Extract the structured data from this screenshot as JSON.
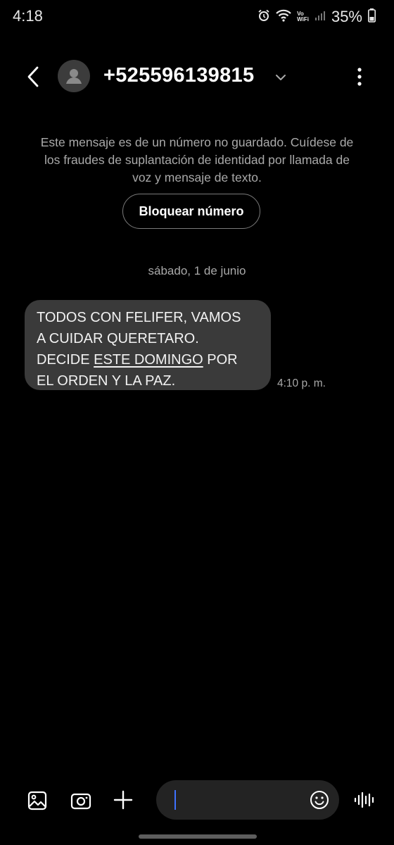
{
  "status": {
    "time": "4:18",
    "volte_top": "Vo",
    "volte_bottom": "WiFi",
    "battery": "35%"
  },
  "header": {
    "contact": "+525596139815"
  },
  "warning": {
    "text": "Este mensaje es de un número no guardado. Cuídese de los fraudes de suplantación de identidad por llamada de voz y mensaje de texto.",
    "block_label": "Bloquear número"
  },
  "date_separator": "sábado, 1 de junio",
  "message": {
    "line1": "TODOS CON FELIFER, VAMOS",
    "line2": "A CUIDAR QUERETARO.",
    "line3_pre": "DECIDE ",
    "line3_link": "ESTE DOMINGO",
    "line3_post": " POR",
    "line4": "EL ORDEN Y LA PAZ.",
    "time": "4:10 p. m."
  },
  "composer": {
    "placeholder": ""
  }
}
